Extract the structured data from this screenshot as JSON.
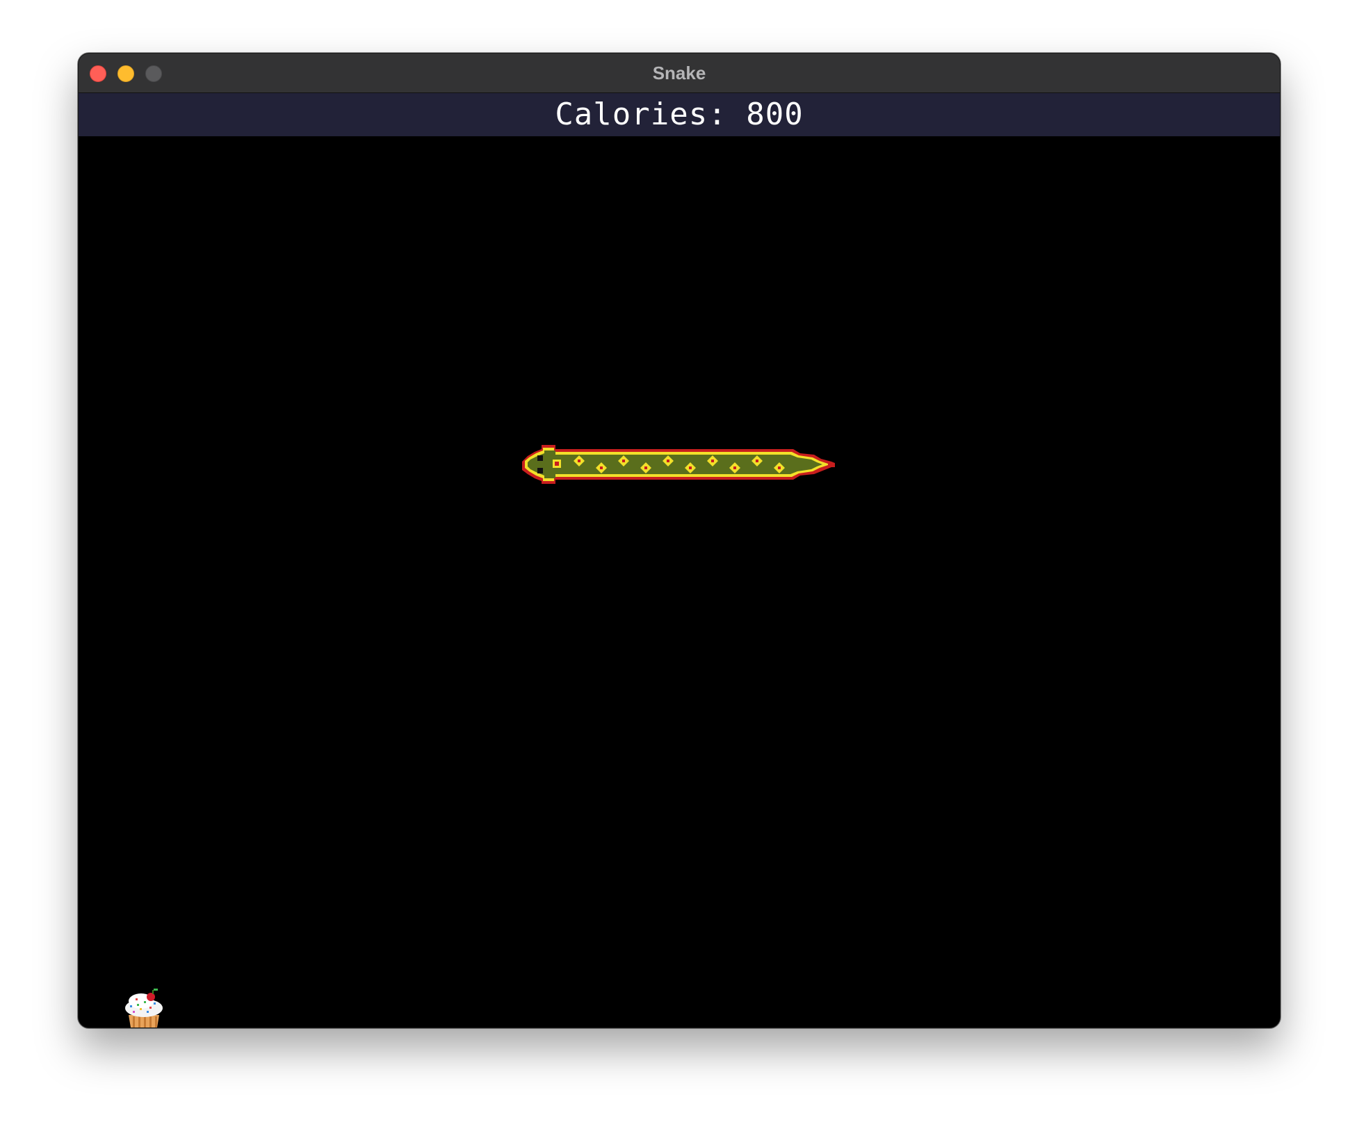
{
  "window": {
    "title": "Snake"
  },
  "hud": {
    "calories_label": "Calories: 800"
  },
  "game": {
    "snake_direction": "left",
    "food_icon": "cupcake-icon",
    "colors": {
      "background": "#000000",
      "hud_bar": "#222238",
      "snake_body": "#5a6e1c",
      "snake_outline": "#c81e1e",
      "snake_pattern": "#f2e02a"
    }
  }
}
